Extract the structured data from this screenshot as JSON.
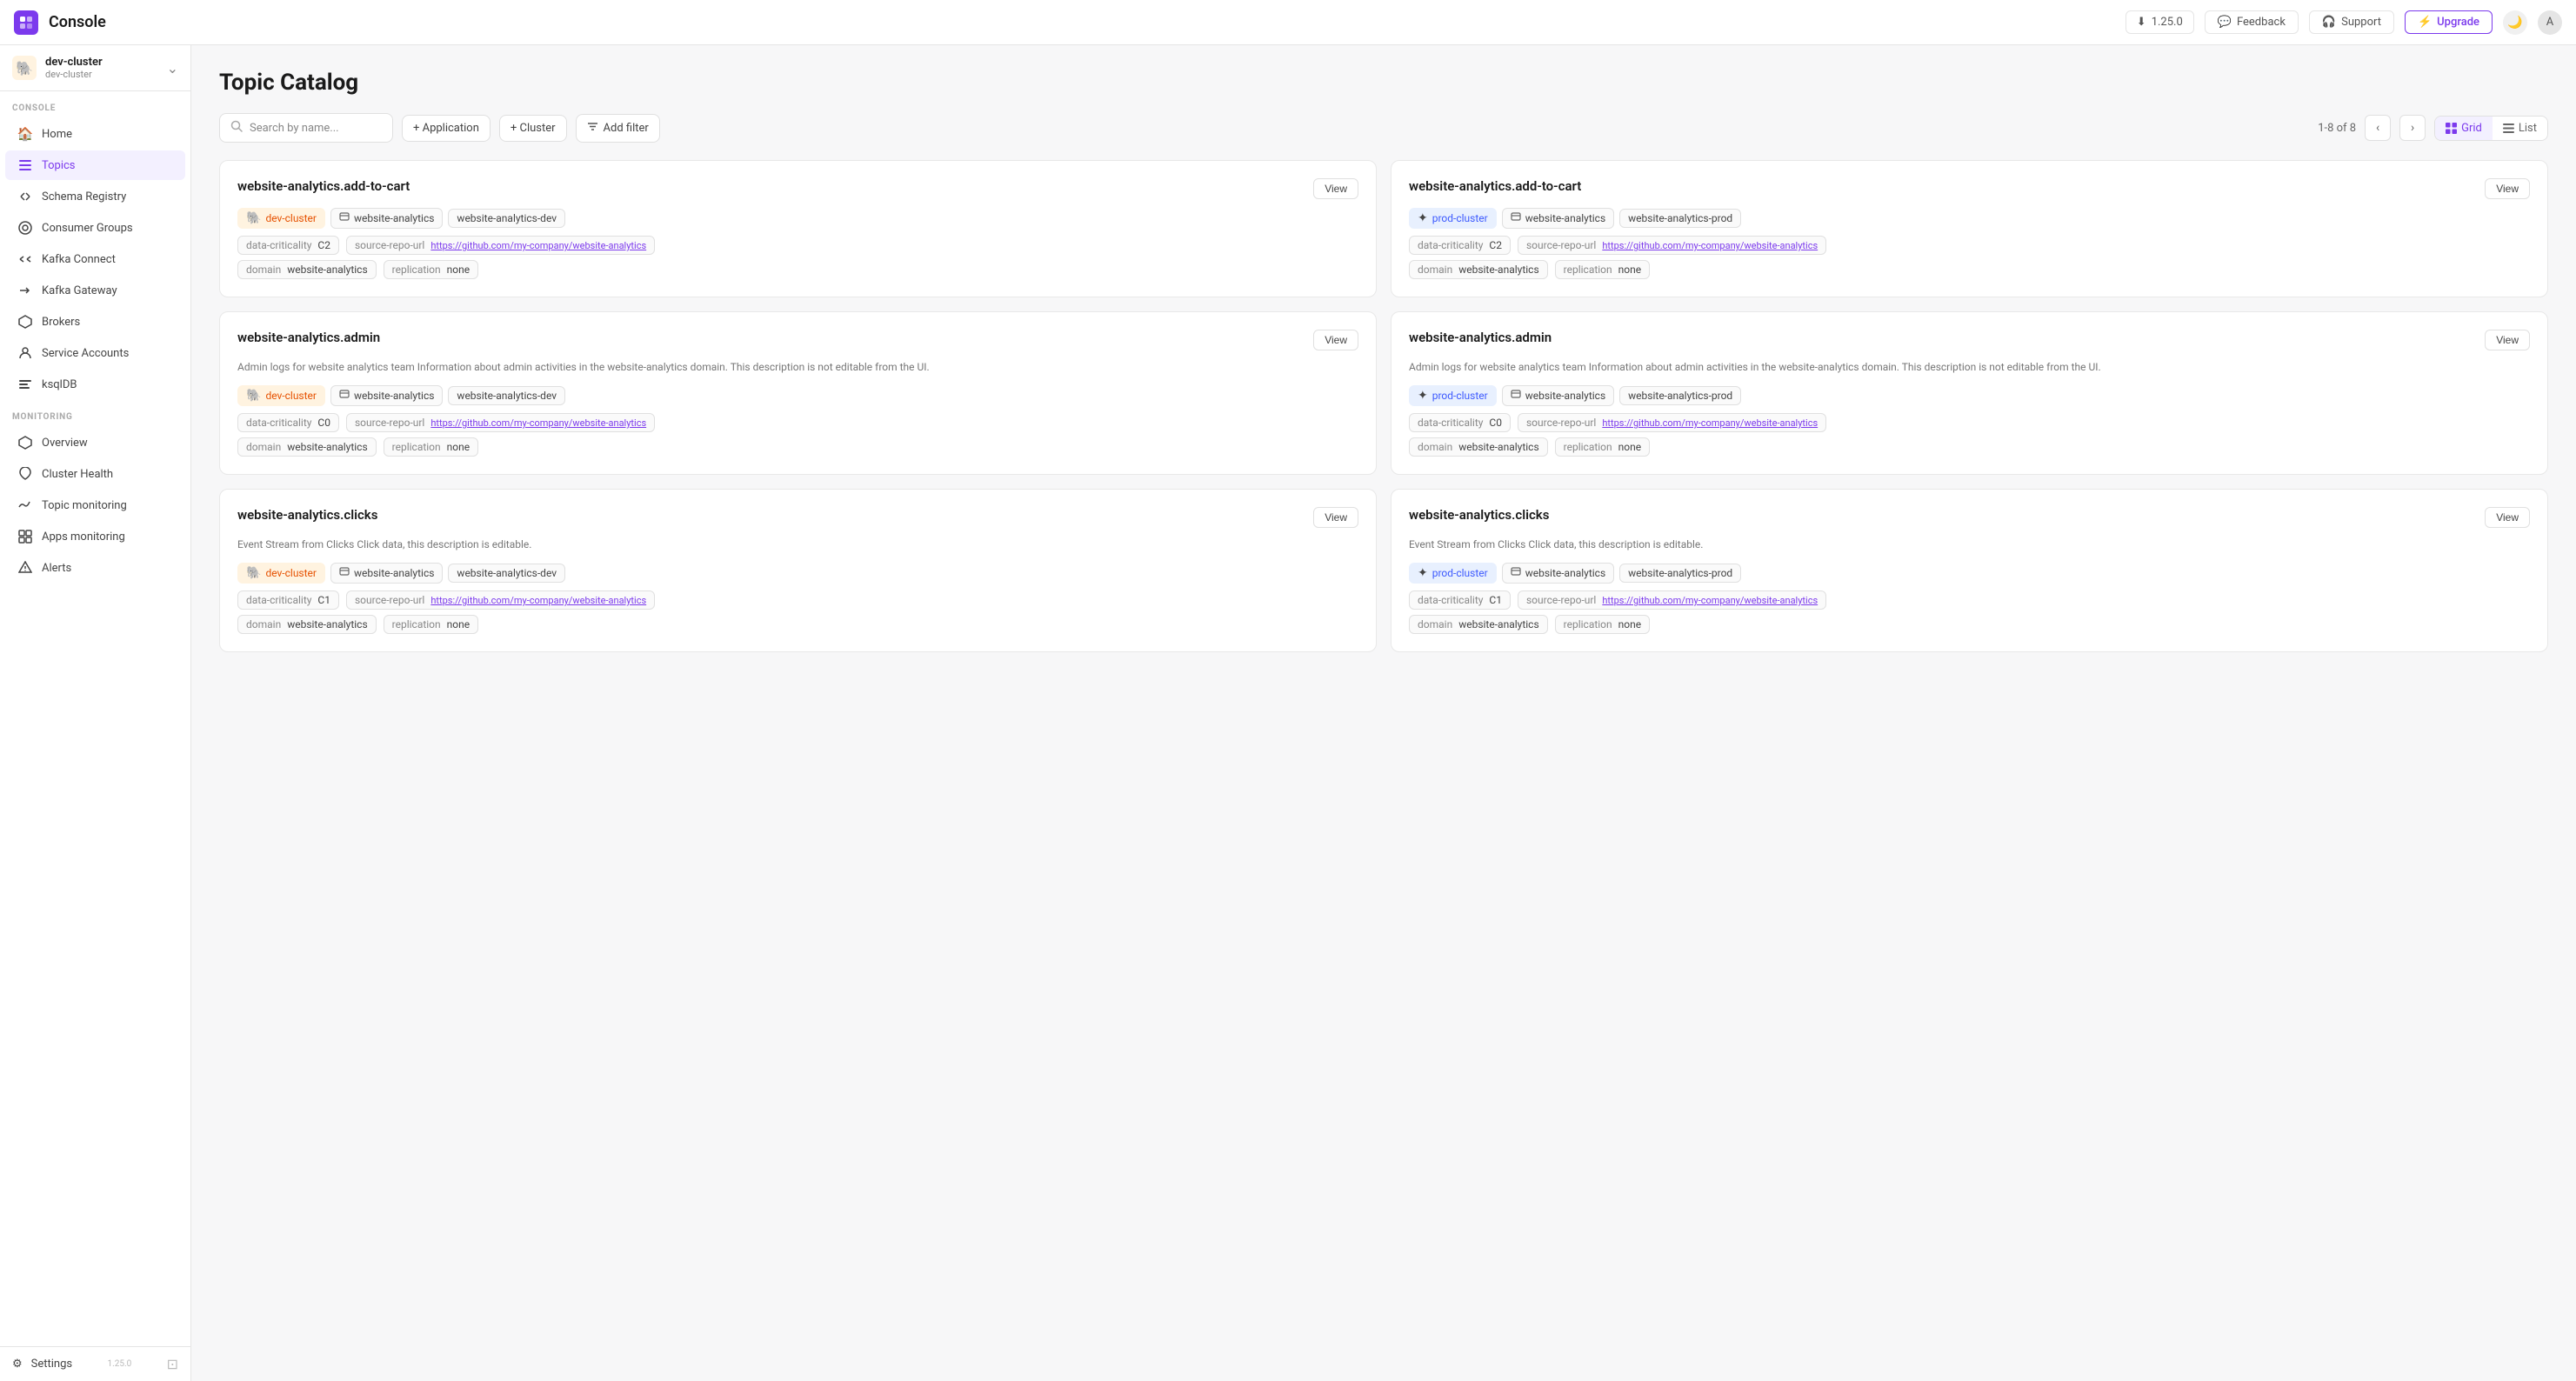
{
  "topbar": {
    "logo": "C",
    "title": "Console",
    "version": "1.25.0",
    "feedback": "Feedback",
    "support": "Support",
    "upgrade": "Upgrade",
    "avatar": "A"
  },
  "cluster": {
    "name": "dev-cluster",
    "sub": "dev-cluster",
    "icon": "🐘"
  },
  "sidebar": {
    "console_label": "CONSOLE",
    "monitoring_label": "MONITORING",
    "items": [
      {
        "id": "home",
        "label": "Home",
        "icon": "🏠"
      },
      {
        "id": "topics",
        "label": "Topics",
        "icon": "☰"
      },
      {
        "id": "schema",
        "label": "Schema Registry",
        "icon": "⟨⟩"
      },
      {
        "id": "consumer-groups",
        "label": "Consumer Groups",
        "icon": "⊙"
      },
      {
        "id": "kafka-connect",
        "label": "Kafka Connect",
        "icon": "⇌"
      },
      {
        "id": "kafka-gateway",
        "label": "Kafka Gateway",
        "icon": "⇒"
      },
      {
        "id": "brokers",
        "label": "Brokers",
        "icon": "⬡"
      },
      {
        "id": "service-accounts",
        "label": "Service Accounts",
        "icon": "👤"
      },
      {
        "id": "ksqldb",
        "label": "ksqlDB",
        "icon": "≡"
      }
    ],
    "monitoring_items": [
      {
        "id": "overview",
        "label": "Overview",
        "icon": "⬡"
      },
      {
        "id": "cluster-health",
        "label": "Cluster Health",
        "icon": "♥"
      },
      {
        "id": "topic-monitoring",
        "label": "Topic monitoring",
        "icon": "〜"
      },
      {
        "id": "apps-monitoring",
        "label": "Apps monitoring",
        "icon": "⊞"
      },
      {
        "id": "alerts",
        "label": "Alerts",
        "icon": "⚠"
      }
    ],
    "settings": "Settings",
    "version": "1.25.0"
  },
  "main": {
    "title": "Topic Catalog",
    "search_placeholder": "Search by name...",
    "filter_application": "+ Application",
    "filter_cluster": "+ Cluster",
    "filter_add": "Add filter",
    "pagination": "1-8 of 8",
    "view_grid": "Grid",
    "view_list": "List"
  },
  "topics": [
    {
      "title": "website-analytics.add-to-cart",
      "description": "",
      "cluster": "dev-cluster",
      "cluster_icon": "🐘",
      "application": "website-analytics",
      "env": "website-analytics-dev",
      "data_criticality_key": "data-criticality",
      "data_criticality_val": "C2",
      "source_repo_key": "source-repo-url",
      "source_repo_val": "https://github.com/my-company/website-analytics",
      "domain_key": "domain",
      "domain_val": "website-analytics",
      "replication_key": "replication",
      "replication_val": "none"
    },
    {
      "title": "website-analytics.add-to-cart",
      "description": "",
      "cluster": "prod-cluster",
      "cluster_icon": "✦",
      "application": "website-analytics",
      "env": "website-analytics-prod",
      "data_criticality_key": "data-criticality",
      "data_criticality_val": "C2",
      "source_repo_key": "source-repo-url",
      "source_repo_val": "https://github.com/my-company/website-analytics",
      "domain_key": "domain",
      "domain_val": "website-analytics",
      "replication_key": "replication",
      "replication_val": "none"
    },
    {
      "title": "website-analytics.admin",
      "description": "Admin logs for website analytics team Information about admin activities in the website-analytics domain. This description is not editable from the UI.",
      "cluster": "dev-cluster",
      "cluster_icon": "🐘",
      "application": "website-analytics",
      "env": "website-analytics-dev",
      "data_criticality_key": "data-criticality",
      "data_criticality_val": "C0",
      "source_repo_key": "source-repo-url",
      "source_repo_val": "https://github.com/my-company/website-analytics",
      "domain_key": "domain",
      "domain_val": "website-analytics",
      "replication_key": "replication",
      "replication_val": "none"
    },
    {
      "title": "website-analytics.admin",
      "description": "Admin logs for website analytics team Information about admin activities in the website-analytics domain. This description is not editable from the UI.",
      "cluster": "prod-cluster",
      "cluster_icon": "✦",
      "application": "website-analytics",
      "env": "website-analytics-prod",
      "data_criticality_key": "data-criticality",
      "data_criticality_val": "C0",
      "source_repo_key": "source-repo-url",
      "source_repo_val": "https://github.com/my-company/website-analytics",
      "domain_key": "domain",
      "domain_val": "website-analytics",
      "replication_key": "replication",
      "replication_val": "none"
    },
    {
      "title": "website-analytics.clicks",
      "description": "Event Stream from Clicks Click data, this description is editable.",
      "cluster": "dev-cluster",
      "cluster_icon": "🐘",
      "application": "website-analytics",
      "env": "website-analytics-dev",
      "data_criticality_key": "data-criticality",
      "data_criticality_val": "C1",
      "source_repo_key": "source-repo-url",
      "source_repo_val": "https://github.com/my-company/website-analytics",
      "domain_key": "domain",
      "domain_val": "website-analytics",
      "replication_key": "replication",
      "replication_val": "none"
    },
    {
      "title": "website-analytics.clicks",
      "description": "Event Stream from Clicks Click data, this description is editable.",
      "cluster": "prod-cluster",
      "cluster_icon": "✦",
      "application": "website-analytics",
      "env": "website-analytics-prod",
      "data_criticality_key": "data-criticality",
      "data_criticality_val": "C1",
      "source_repo_key": "source-repo-url",
      "source_repo_val": "https://github.com/my-company/website-analytics",
      "domain_key": "domain",
      "domain_val": "website-analytics",
      "replication_key": "replication",
      "replication_val": "none"
    }
  ]
}
